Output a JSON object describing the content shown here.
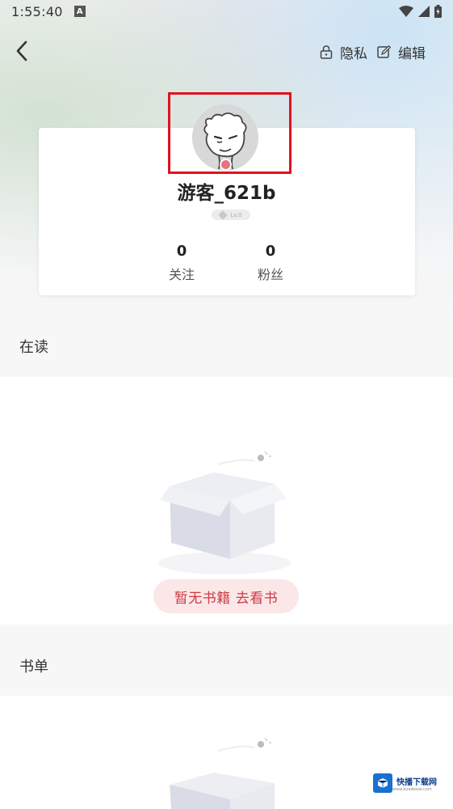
{
  "status_bar": {
    "time": "1:55:40",
    "notification_glyph": "A"
  },
  "nav": {
    "privacy_label": "隐私",
    "edit_label": "编辑"
  },
  "profile": {
    "username": "游客_621b",
    "level_text": "Lv.0",
    "following_count": "0",
    "following_label": "关注",
    "fans_count": "0",
    "fans_label": "粉丝"
  },
  "reading_section": {
    "title": "在读",
    "empty_cta": "暂无书籍 去看书"
  },
  "booklist_section": {
    "title": "书单"
  },
  "watermark": {
    "text": "快播下载网",
    "sub": "www.kuaiboxw.com"
  },
  "colors": {
    "highlight_box": "#e0121f",
    "cta_text": "#cc3a44",
    "cta_bg": "#fbe7e8"
  }
}
